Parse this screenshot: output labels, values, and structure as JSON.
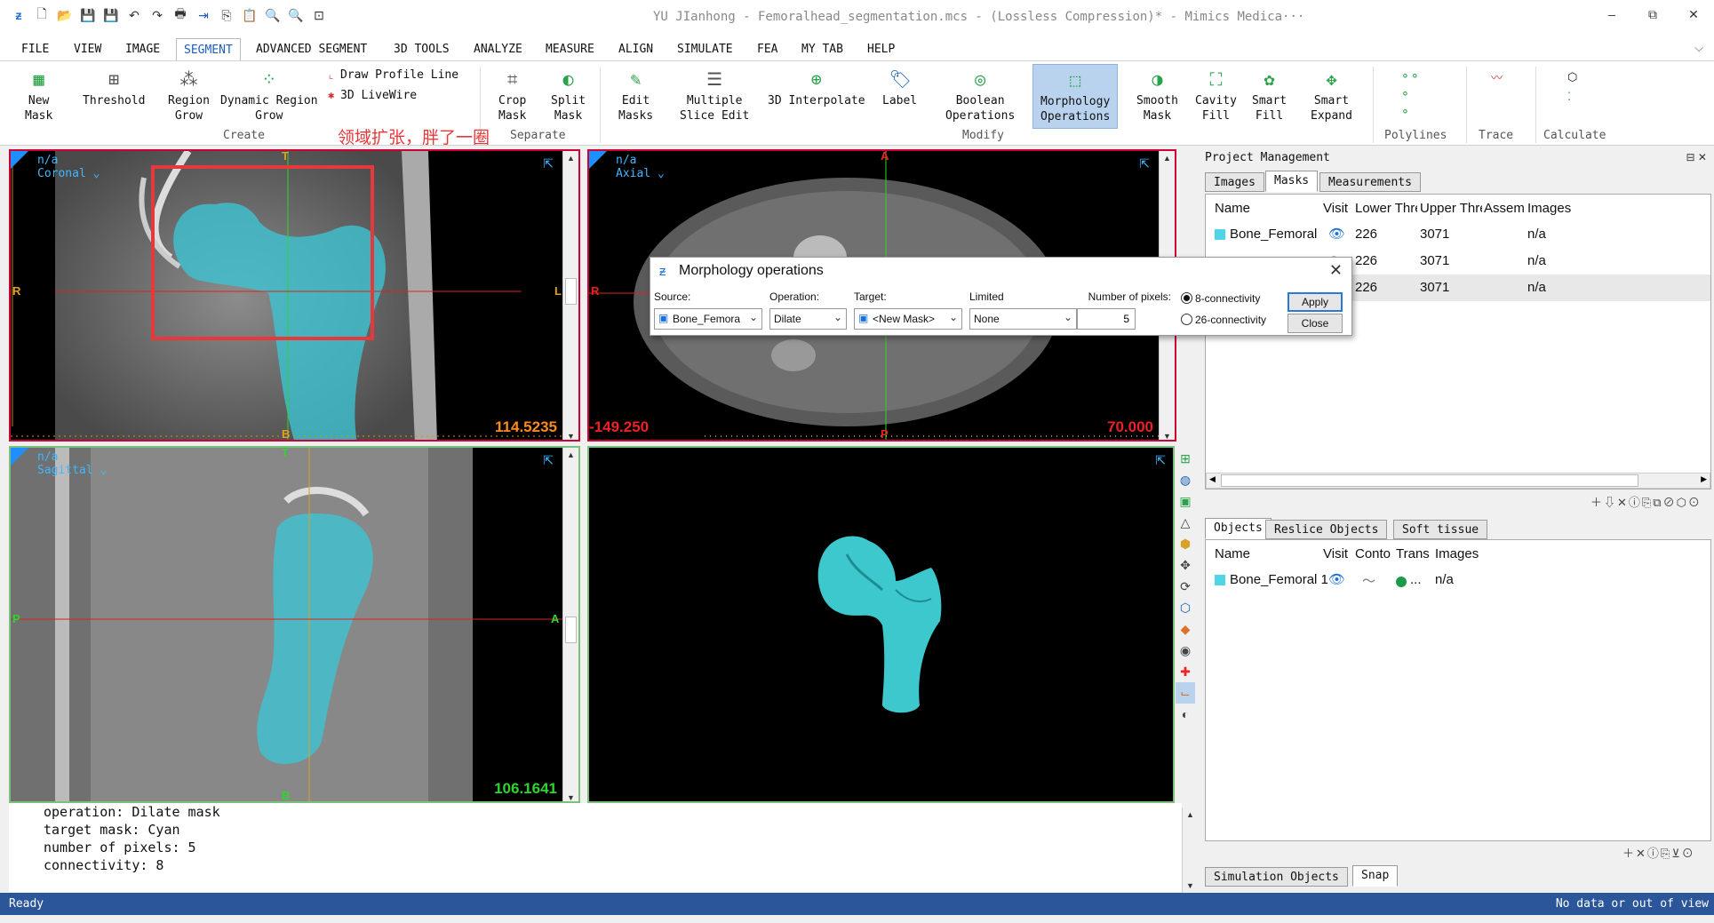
{
  "window": {
    "title": "YU JIanhong - Femoralhead_segmentation.mcs -  (Lossless Compression)* - Mimics Medica···",
    "quick_access_icons": [
      "app-logo-icon",
      "new-file-icon",
      "open-folder-icon",
      "save-icon",
      "save-as-icon",
      "undo-icon",
      "redo-icon",
      "print-icon",
      "export-icon",
      "copy-icon",
      "paste-icon",
      "zoom-in-icon",
      "zoom-out-icon",
      "zoom-fit-icon"
    ],
    "controls": {
      "minimize": "–",
      "maximize": "⧉",
      "close": "✕"
    }
  },
  "menu": {
    "items": [
      "FILE",
      "VIEW",
      "IMAGE",
      "SEGMENT",
      "ADVANCED SEGMENT",
      "3D TOOLS",
      "ANALYZE",
      "MEASURE",
      "ALIGN",
      "SIMULATE",
      "FEA",
      "MY TAB",
      "HELP"
    ],
    "active": "SEGMENT"
  },
  "ribbon": {
    "create": {
      "group": "Create",
      "new_mask": "New\nMask",
      "threshold": "Threshold",
      "region_grow": "Region\nGrow",
      "dynamic_region_grow": "Dynamic Region\nGrow",
      "draw_profile_line": "Draw Profile Line",
      "livewire": "3D LiveWire"
    },
    "separate": {
      "group": "Separate",
      "crop_mask": "Crop\nMask",
      "split_mask": "Split\nMask"
    },
    "modify": {
      "group": "Modify",
      "edit_masks": "Edit\nMasks",
      "multiple_slice_edit": "Multiple\nSlice Edit",
      "interpolate": "3D Interpolate",
      "label": "Label",
      "boolean": "Boolean\nOperations",
      "morphology": "Morphology\nOperations",
      "smooth_mask": "Smooth\nMask",
      "cavity_fill": "Cavity\nFill",
      "smart_fill": "Smart\nFill",
      "smart_expand": "Smart\nExpand"
    },
    "polylines": "Polylines",
    "trace": "Trace",
    "calculate": "Calculate"
  },
  "annotation": {
    "text": "领域扩张，胖了一圈",
    "color": "#e8393a"
  },
  "viewports": {
    "coronal": {
      "line1": "n/a",
      "line2": "Coronal ⌄",
      "top": "T",
      "bottom": "B",
      "left": "R",
      "right": "L",
      "value": "114.5235"
    },
    "axial": {
      "line1": "n/a",
      "line2": "Axial ⌄",
      "top": "A",
      "bottom": "P",
      "left": "R",
      "value_left": "-149.250",
      "value": "70.000"
    },
    "sagittal": {
      "line1": "n/a",
      "line2": "Sagittal ⌄",
      "top": "T",
      "bottom": "B",
      "left": "P",
      "right": "A",
      "value": "106.1641"
    }
  },
  "dialog": {
    "title": "Morphology operations",
    "source_label": "Source:",
    "source_value": "Bone_Femora",
    "operation_label": "Operation:",
    "operation_value": "Dilate",
    "target_label": "Target:",
    "target_value": "<New Mask>",
    "limited_label": "Limited",
    "limited_value": "None",
    "pixels_label": "Number of pixels:",
    "pixels_value": "5",
    "conn8": "8-connectivity",
    "conn26": "26-connectivity",
    "apply": "Apply",
    "close": "Close"
  },
  "project": {
    "title": "Project Management",
    "tabs": [
      "Images",
      "Masks",
      "Measurements"
    ],
    "active_tab": "Masks",
    "columns": [
      "Name",
      "Visit",
      "Lower Thre",
      "Upper Thre",
      "Assem",
      "Images"
    ],
    "rows": [
      {
        "name": "Bone_Femoral",
        "lower": "226",
        "upper": "3071",
        "images": "n/a"
      },
      {
        "name": "",
        "lower": "226",
        "upper": "3071",
        "images": "n/a"
      },
      {
        "name": "",
        "lower": "226",
        "upper": "3071",
        "images": "n/a"
      }
    ],
    "mask_color": "#4fd6e6"
  },
  "objects": {
    "tabs": [
      "Objects",
      "Reslice Objects",
      "Soft tissue"
    ],
    "active_tab": "Objects",
    "columns": [
      "Name",
      "Visit",
      "Conto",
      "Trans",
      "Images"
    ],
    "rows": [
      {
        "name": "Bone_Femoral 1",
        "trans": "...",
        "images": "n/a"
      }
    ],
    "bottom_tabs": [
      "Simulation Objects",
      "Snap"
    ]
  },
  "log": {
    "lines": [
      "operation: Dilate mask",
      "target mask: Cyan",
      "number of pixels: 5",
      "connectivity: 8"
    ]
  },
  "status": {
    "left": "Ready",
    "right": "No data or out of view"
  }
}
